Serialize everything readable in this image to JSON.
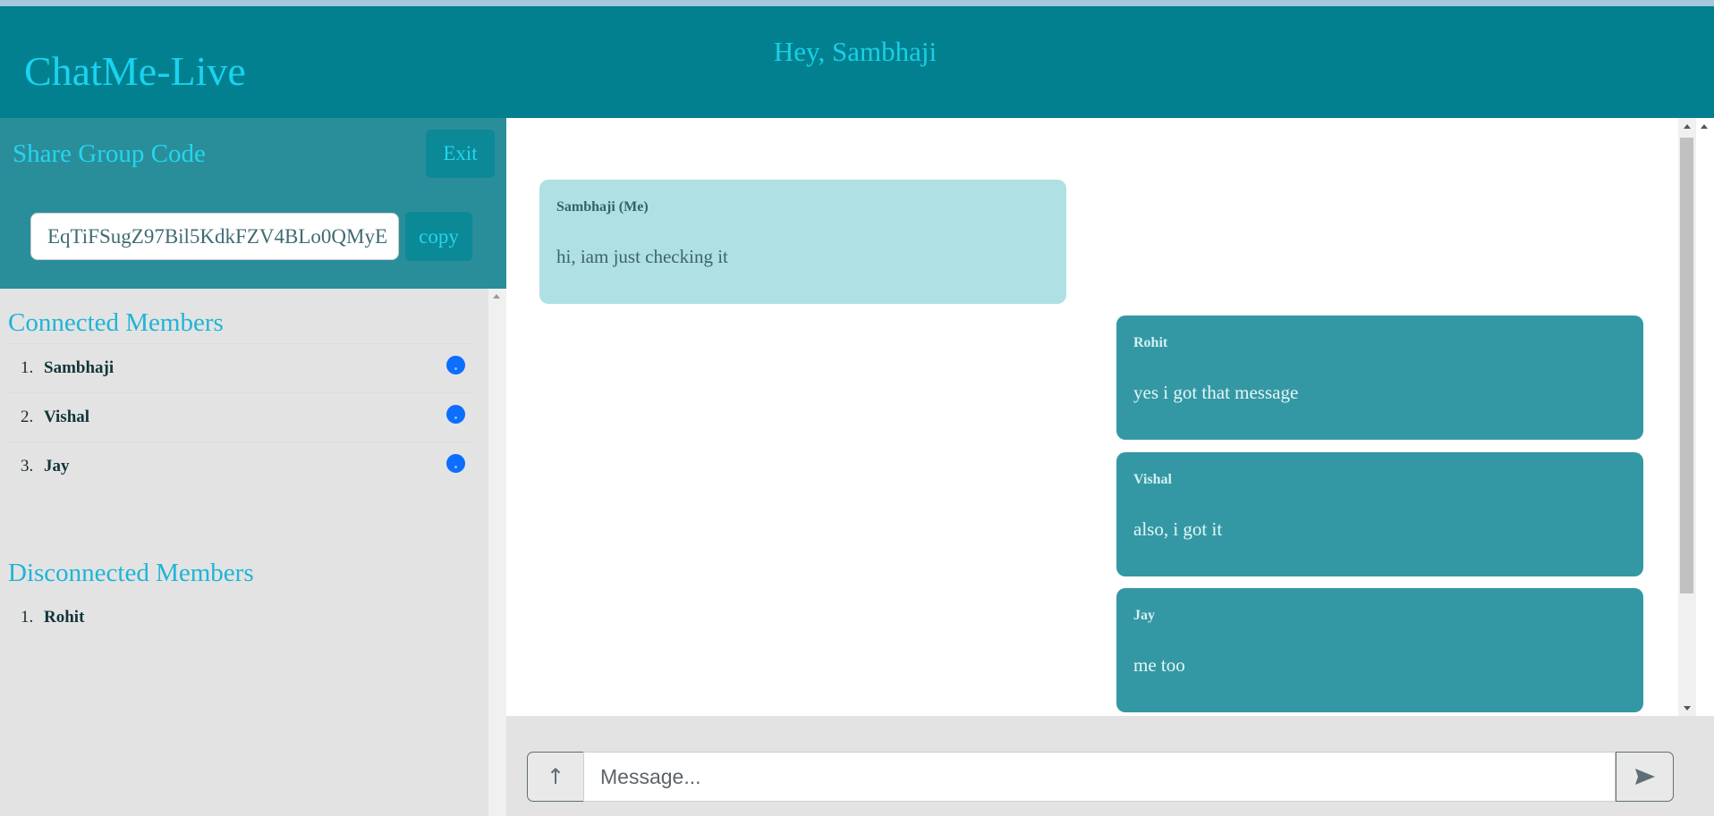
{
  "app": {
    "brand": "ChatMe-Live",
    "greeting": "Hey, Sambhaji"
  },
  "share": {
    "title": "Share Group Code",
    "exit_label": "Exit",
    "code_value": "EqTiFSugZ97Bil5KdkFZV4BLo0QMyE",
    "copy_label": "copy"
  },
  "connected": {
    "title": "Connected Members",
    "members": [
      {
        "num": "1.",
        "name": "Sambhaji",
        "status_icon": "online-status-icon"
      },
      {
        "num": "2.",
        "name": "Vishal",
        "status_icon": "online-status-icon"
      },
      {
        "num": "3.",
        "name": "Jay",
        "status_icon": "online-status-icon"
      }
    ]
  },
  "disconnected": {
    "title": "Disconnected Members",
    "members": [
      {
        "num": "1.",
        "name": "Rohit"
      }
    ]
  },
  "messages": [
    {
      "sender": "Sambhaji (Me)",
      "text": "hi, iam just checking it",
      "mine": true
    },
    {
      "sender": "Rohit",
      "text": "yes i got that message",
      "mine": false
    },
    {
      "sender": "Vishal",
      "text": "also, i got it",
      "mine": false
    },
    {
      "sender": "Jay",
      "text": "me too",
      "mine": false
    }
  ],
  "composer": {
    "upload_icon": "upload-arrow-icon",
    "upload_glyph": "↑",
    "placeholder": "Message...",
    "send_icon": "send-icon"
  },
  "colors": {
    "header": "#02808f",
    "share_panel": "#2a8e9a",
    "accent_text": "#19d3f0",
    "own_message": "#afe0e4",
    "other_message": "#3498a4",
    "online_dot": "#0d6efd"
  }
}
